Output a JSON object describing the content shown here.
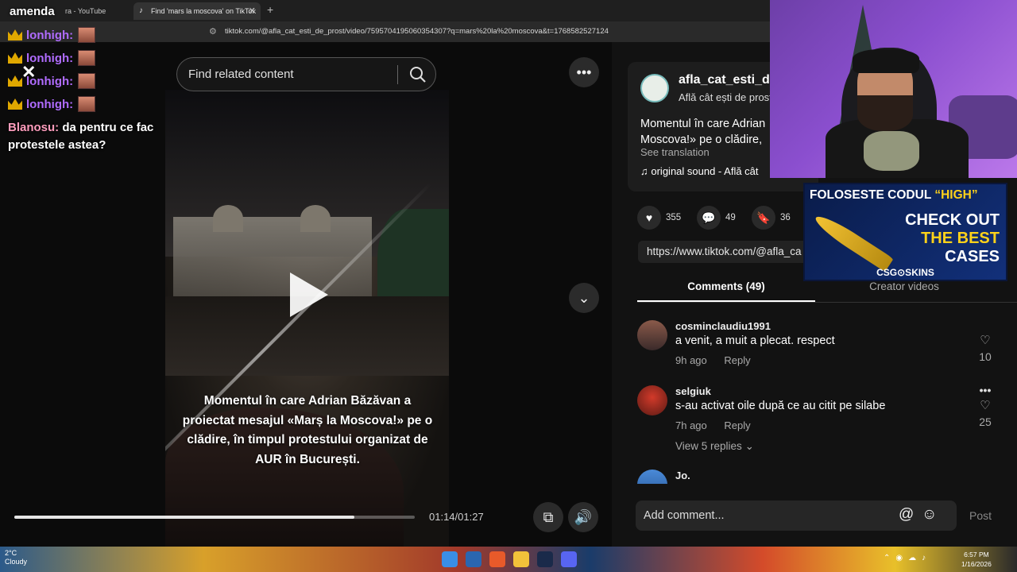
{
  "browser": {
    "tabs": [
      {
        "label": "ra - YouTube",
        "active": false
      },
      {
        "label": "Find 'mars la moscova' on TikTok",
        "active": true
      }
    ],
    "url": "tiktok.com/@afla_cat_esti_de_prost/video/7595704195060354307?q=mars%20la%20moscova&t=1768582527124"
  },
  "video": {
    "search_placeholder": "Find related content",
    "caption": "Momentul în care Adrian Băzăvan a proiectat mesajul «Marș la Moscova!» pe o clădire, în timpul protestului organizat de AUR în București.",
    "time": "01:14/01:27",
    "progress_fraction": 0.85
  },
  "post": {
    "author": "afla_cat_esti_de",
    "author_sub": "Află cât ești de prost",
    "desc_line1": "Momentul în care Adrian",
    "desc_line2": "Moscova!» pe o clădire,",
    "see_translation": "See translation",
    "sound": "original sound - Află cât",
    "likes": "355",
    "comments": "49",
    "saves": "36",
    "link": "https://www.tiktok.com/@afla_ca"
  },
  "tabs": {
    "comments": "Comments (49)",
    "creator": "Creator videos"
  },
  "comments": [
    {
      "user": "cosminclaudiu1991",
      "text": "a venit, a muit a plecat. respect",
      "time": "9h ago",
      "reply": "Reply",
      "likes": "10"
    },
    {
      "user": "selgiuk",
      "text": "s-au activat oile după ce au citit pe silabe",
      "time": "7h ago",
      "reply": "Reply",
      "likes": "25",
      "view_replies": "View 5 replies"
    },
    {
      "user": "Jo."
    }
  ],
  "add_comment": {
    "placeholder": "Add comment...",
    "post": "Post"
  },
  "chat": {
    "top_name": "amenda",
    "lines": [
      "lonhigh:",
      "lonhigh:",
      "lonhigh:",
      "lonhigh:"
    ],
    "message_user": "Blanosu:",
    "message_text": "da pentru ce fac protestele astea?"
  },
  "ad": {
    "top_prefix": "FOLOSESTE CODUL ",
    "top_code": "“HIGH”",
    "check1": "CHECK OUT",
    "check2": "THE BEST",
    "check3": "CASES",
    "brand": "CSG⊙SKINS"
  },
  "taskbar": {
    "temp": "2°C",
    "weather": "Cloudy",
    "time": "6:57 PM",
    "date": "1/16/2026"
  },
  "colors": {
    "chat_nick": "#b06cff",
    "chat_user": "#ff9dbd",
    "ad_yellow": "#ffd21a",
    "accent_bg": "#121212"
  }
}
